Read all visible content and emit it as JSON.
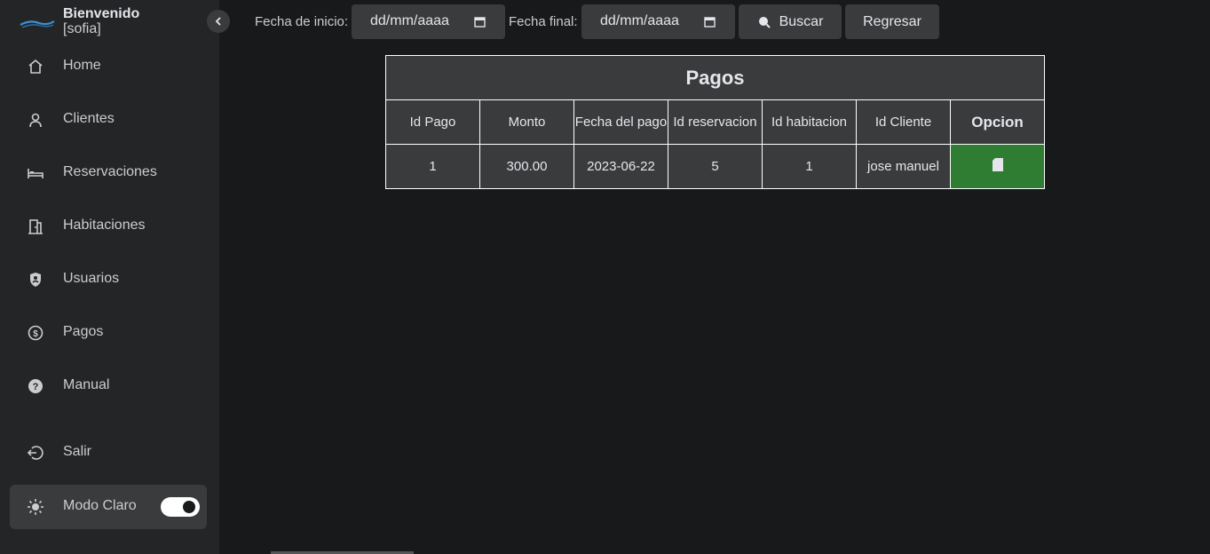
{
  "sidebar": {
    "welcome": "Bienvenido",
    "user": "[sofia]",
    "items": [
      {
        "label": "Home",
        "icon": "home-icon"
      },
      {
        "label": "Clientes",
        "icon": "user-icon"
      },
      {
        "label": "Reservaciones",
        "icon": "bed-icon"
      },
      {
        "label": "Habitaciones",
        "icon": "door-icon"
      },
      {
        "label": "Usuarios",
        "icon": "shield-user-icon"
      },
      {
        "label": "Pagos",
        "icon": "dollar-icon"
      },
      {
        "label": "Manual",
        "icon": "help-icon"
      }
    ],
    "logout": "Salir",
    "mode_label": "Modo Claro",
    "mode_on": true
  },
  "filters": {
    "start_label": "Fecha de inicio:",
    "start_value": "dd/mm/aaaa",
    "end_label": "Fecha final:",
    "end_value": "dd/mm/aaaa",
    "search_label": "Buscar",
    "back_label": "Regresar"
  },
  "table": {
    "title": "Pagos",
    "headers": [
      "Id Pago",
      "Monto",
      "Fecha del pago",
      "Id reservacion",
      "Id habitacion",
      "Id Cliente",
      "Opcion"
    ],
    "rows": [
      [
        "1",
        "300.00",
        "2023-06-22",
        "5",
        "1",
        "jose manuel"
      ]
    ]
  },
  "colors": {
    "sidebar_bg": "#242526",
    "page_bg": "#18191a",
    "control_bg": "#3a3b3c",
    "option_green": "#2e7d32"
  }
}
